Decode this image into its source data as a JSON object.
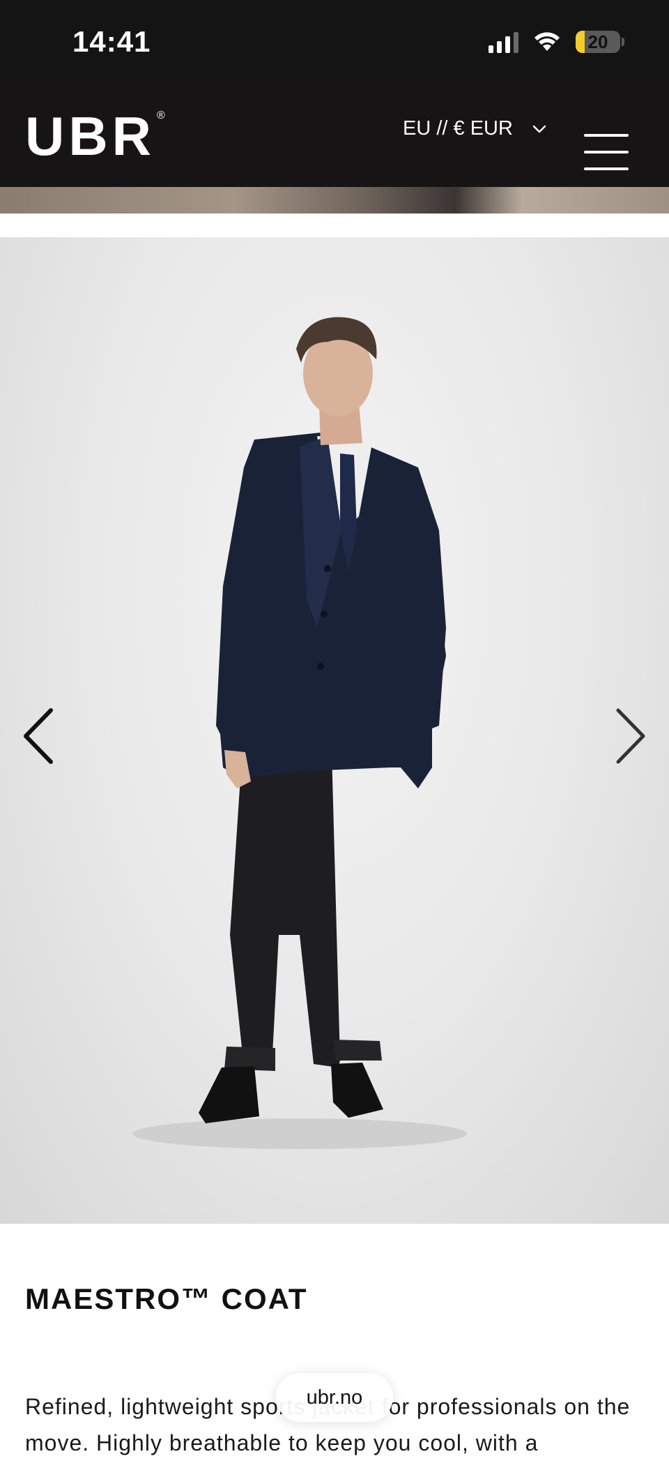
{
  "status_bar": {
    "time": "14:41",
    "battery_level": "20",
    "battery_fraction": 0.2,
    "battery_color": "#f4cc2a"
  },
  "header": {
    "logo_text": "UBR",
    "logo_mark": "®",
    "currency_label": "EU // € EUR",
    "currency_icon": "chevron-down-icon",
    "menu_icon": "hamburger-menu-icon",
    "background": "#161414"
  },
  "carousel": {
    "prev_icon": "chevron-left-icon",
    "next_icon": "chevron-right-icon"
  },
  "product": {
    "title": "MAESTRO™ COAT",
    "description": "Refined, lightweight sports jacket for professionals on the move. Highly breathable to keep you cool, with a"
  },
  "browser": {
    "url": "ubr.no"
  }
}
